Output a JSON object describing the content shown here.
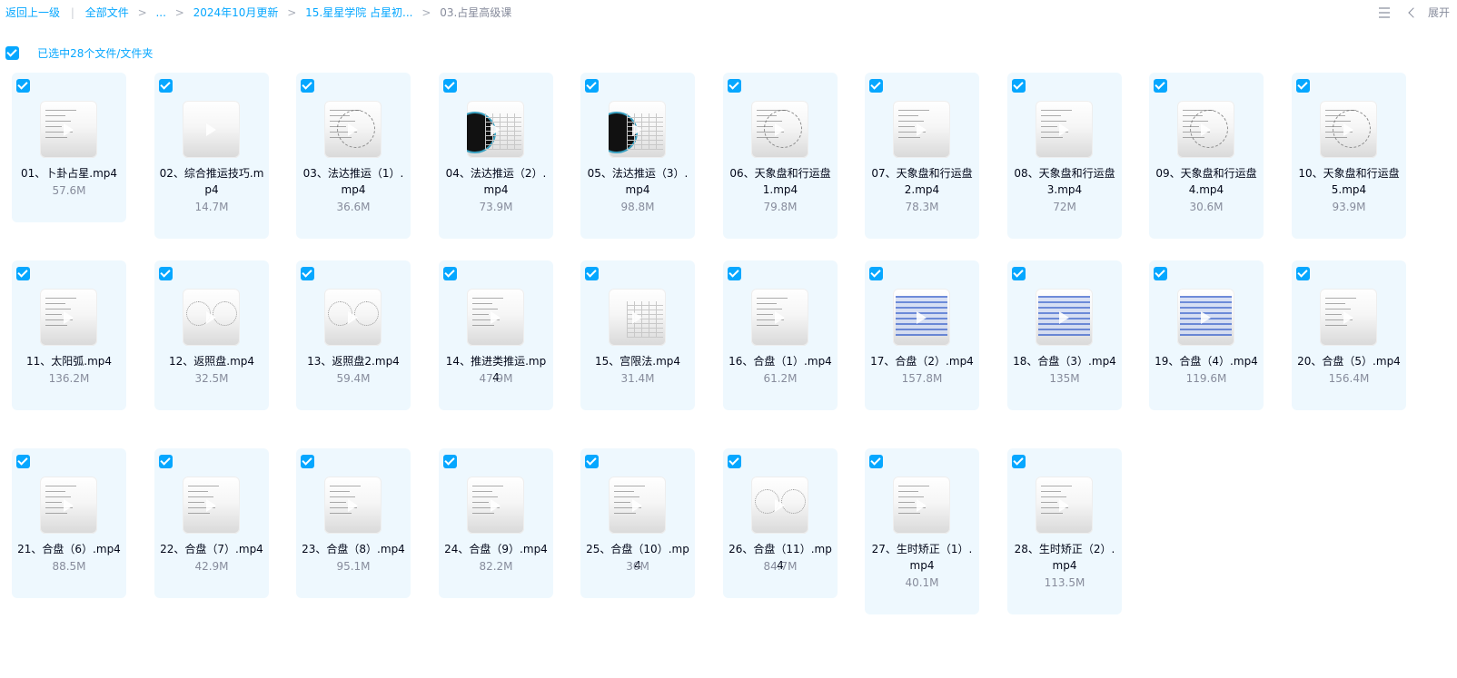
{
  "breadcrumb": {
    "back": "返回上一级",
    "separator": "|",
    "items": [
      "全部文件",
      "...",
      "2024年10月更新",
      "15.星星学院 占星初...",
      "03.占星高级课"
    ]
  },
  "toolbar": {
    "list_icon": "list-view-icon",
    "collapse_icon": "chevron-left-icon",
    "expand_label": "展开"
  },
  "selection": {
    "text": "已选中28个文件/文件夹",
    "checked": true
  },
  "colors": {
    "accent": "#06a7ff",
    "card_bg": "#eef8fe",
    "muted": "#878c9c"
  },
  "files": [
    {
      "name": "01、卜卦占星.mp4",
      "size": "57.6M",
      "thumb": "text"
    },
    {
      "name": "02、综合推运技巧.mp4",
      "size": "14.7M",
      "thumb": "blank"
    },
    {
      "name": "03、法达推运（1）.mp4",
      "size": "36.6M",
      "thumb": "star"
    },
    {
      "name": "04、法达推运（2）.mp4",
      "size": "73.9M",
      "thumb": "dark-table"
    },
    {
      "name": "05、法达推运（3）.mp4",
      "size": "98.8M",
      "thumb": "dark-table"
    },
    {
      "name": "06、天象盘和行运盘1.mp4",
      "size": "79.8M",
      "thumb": "wheel"
    },
    {
      "name": "07、天象盘和行运盘2.mp4",
      "size": "78.3M",
      "thumb": "text"
    },
    {
      "name": "08、天象盘和行运盘3.mp4",
      "size": "72M",
      "thumb": "text"
    },
    {
      "name": "09、天象盘和行运盘4.mp4",
      "size": "30.6M",
      "thumb": "wheel"
    },
    {
      "name": "10、天象盘和行运盘5.mp4",
      "size": "93.9M",
      "thumb": "wheel"
    },
    {
      "name": "11、太阳弧.mp4",
      "size": "136.2M",
      "thumb": "text"
    },
    {
      "name": "12、返照盘.mp4",
      "size": "32.5M",
      "thumb": "double-wheel"
    },
    {
      "name": "13、返照盘2.mp4",
      "size": "59.4M",
      "thumb": "double-wheel"
    },
    {
      "name": "14、推进类推运.mp4",
      "size": "47.9M",
      "thumb": "text"
    },
    {
      "name": "15、宫限法.mp4",
      "size": "31.4M",
      "thumb": "table"
    },
    {
      "name": "16、合盘（1）.mp4",
      "size": "61.2M",
      "thumb": "text"
    },
    {
      "name": "17、合盘（2）.mp4",
      "size": "157.8M",
      "thumb": "blue-table"
    },
    {
      "name": "18、合盘（3）.mp4",
      "size": "135M",
      "thumb": "blue-table"
    },
    {
      "name": "19、合盘（4）.mp4",
      "size": "119.6M",
      "thumb": "blue-table"
    },
    {
      "name": "20、合盘（5）.mp4",
      "size": "156.4M",
      "thumb": "text"
    },
    {
      "name": "21、合盘（6）.mp4",
      "size": "88.5M",
      "thumb": "text"
    },
    {
      "name": "22、合盘（7）.mp4",
      "size": "42.9M",
      "thumb": "text"
    },
    {
      "name": "23、合盘（8）.mp4",
      "size": "95.1M",
      "thumb": "text"
    },
    {
      "name": "24、合盘（9）.mp4",
      "size": "82.2M",
      "thumb": "text"
    },
    {
      "name": "25、合盘（10）.mp4",
      "size": "30M",
      "thumb": "text"
    },
    {
      "name": "26、合盘（11）.mp4",
      "size": "84.7M",
      "thumb": "double-wheel"
    },
    {
      "name": "27、生时矫正（1）.mp4",
      "size": "40.1M",
      "thumb": "text"
    },
    {
      "name": "28、生时矫正（2）.mp4",
      "size": "113.5M",
      "thumb": "text"
    }
  ]
}
